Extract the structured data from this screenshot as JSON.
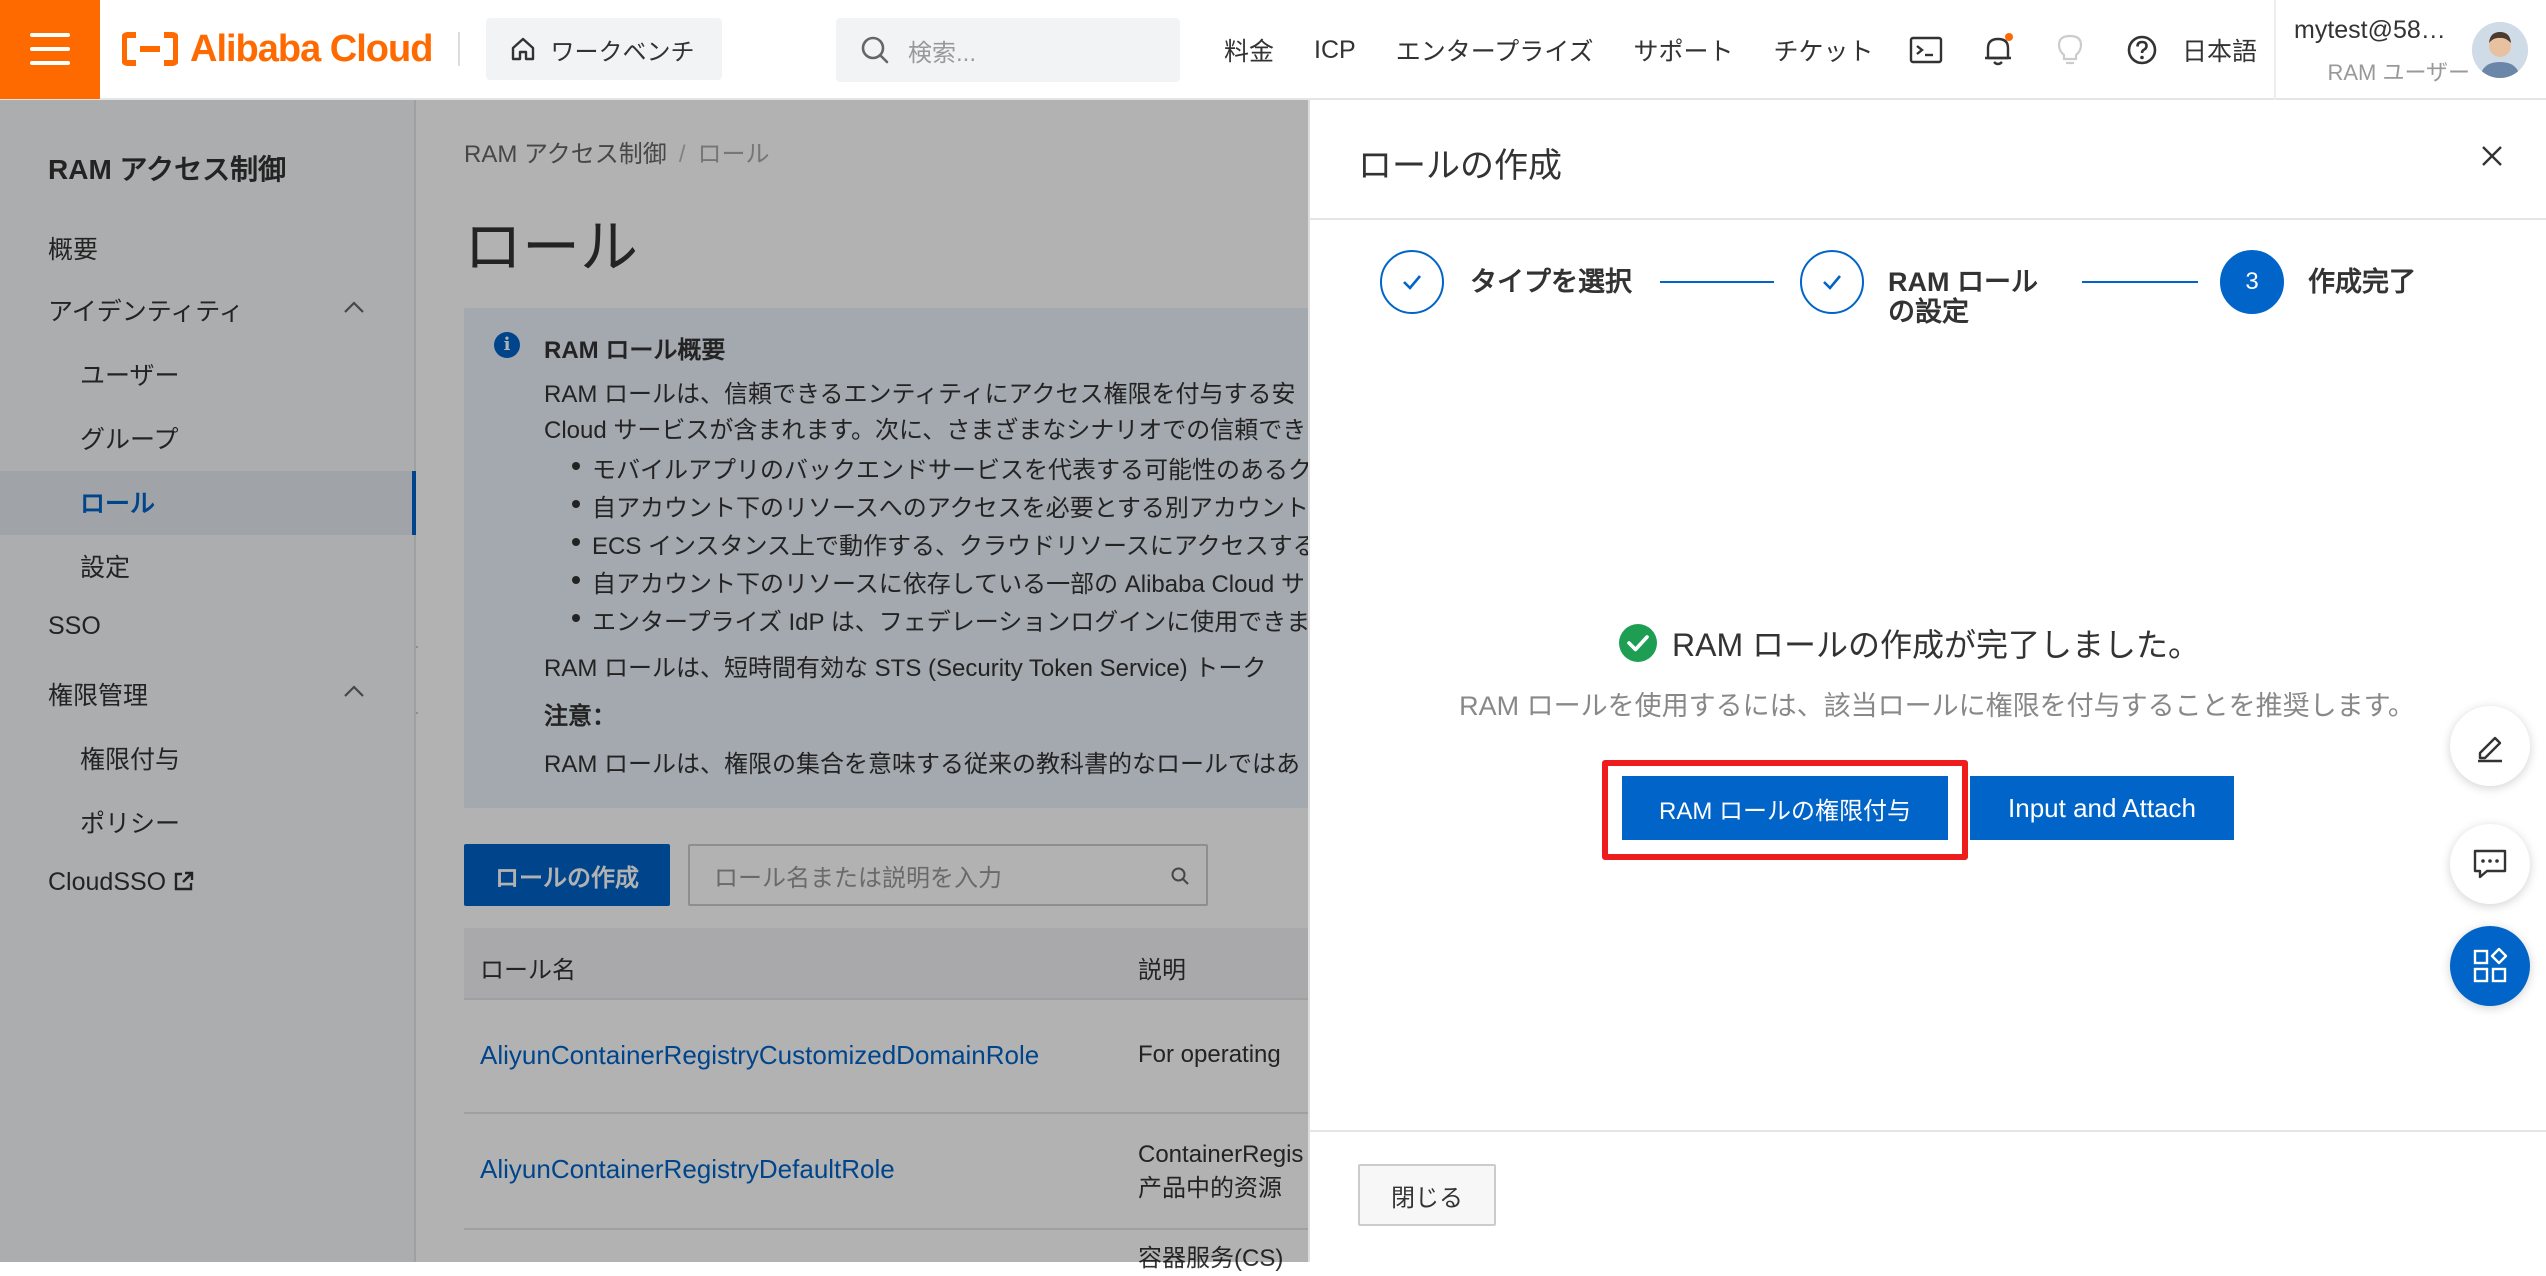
{
  "topbar": {
    "brand": "Alibaba Cloud",
    "workbench": "ワークベンチ",
    "search_placeholder": "検索...",
    "links": [
      "料金",
      "ICP",
      "エンタープライズ",
      "サポート",
      "チケット"
    ],
    "language": "日本語",
    "user_name": "mytest@58…",
    "user_role": "RAM ユーザー"
  },
  "sidebar": {
    "title": "RAM アクセス制御",
    "overview": "概要",
    "identity": "アイデンティティ",
    "users": "ユーザー",
    "groups": "グループ",
    "roles": "ロール",
    "settings": "設定",
    "sso": "SSO",
    "permissions": "権限管理",
    "grants": "権限付与",
    "policies": "ポリシー",
    "cloudsso": "CloudSSO"
  },
  "main": {
    "breadcrumb_root": "RAM アクセス制御",
    "breadcrumb_sep": "/",
    "breadcrumb_current": "ロール",
    "title": "ロール",
    "info_title": "RAM ロール概要",
    "info_line1": "RAM ロールは、信頼できるエンティティにアクセス権限を付与する安",
    "info_line2": "Cloud サービスが含まれます。次に、さまざまなシナリオでの信頼でき",
    "bullets": [
      "モバイルアプリのバックエンドサービスを代表する可能性のあるク",
      "自アカウント下のリソースへのアクセスを必要とする別アカウント",
      "ECS インスタンス上で動作する、クラウドリソースにアクセスする",
      "自アカウント下のリソースに依存している一部の Alibaba Cloud サ",
      "エンタープライズ IdP は、フェデレーションログインに使用できま"
    ],
    "info_line3": "RAM ロールは、短時間有効な STS (Security Token Service) トーク",
    "note_label": "注意：",
    "info_line4": "RAM ロールは、権限の集合を意味する従来の教科書的なロールではあ",
    "create_button": "ロールの作成",
    "role_search_placeholder": "ロール名または説明を入力",
    "col_name": "ロール名",
    "col_desc": "説明",
    "rows": [
      {
        "name": "AliyunContainerRegistryCustomizedDomainRole",
        "desc1": "For operating",
        "desc2": ""
      },
      {
        "name": "AliyunContainerRegistryDefaultRole",
        "desc1": "ContainerRegis",
        "desc2": "产品中的资源"
      },
      {
        "name": "",
        "desc1": "容器服务(CS)",
        "desc2": ""
      }
    ]
  },
  "drawer": {
    "title": "ロールの作成",
    "steps": [
      {
        "label": "タイプを選択",
        "label2": "",
        "state": "done"
      },
      {
        "label": "RAM ロール",
        "label2": "の設定",
        "state": "done"
      },
      {
        "label": "作成完了",
        "label2": "",
        "state": "active",
        "number": "3"
      }
    ],
    "success_message": "RAM ロールの作成が完了しました。",
    "success_sub": "RAM ロールを使用するには、該当ロールに権限を付与することを推奨します。",
    "grant_button": "RAM ロールの権限付与",
    "attach_button": "Input and Attach",
    "close_button": "閉じる"
  },
  "colors": {
    "brand_orange": "#ff6a00",
    "primary_blue": "#0064c8",
    "success_green": "#1e9e52",
    "highlight_red": "#ee1c1c"
  }
}
